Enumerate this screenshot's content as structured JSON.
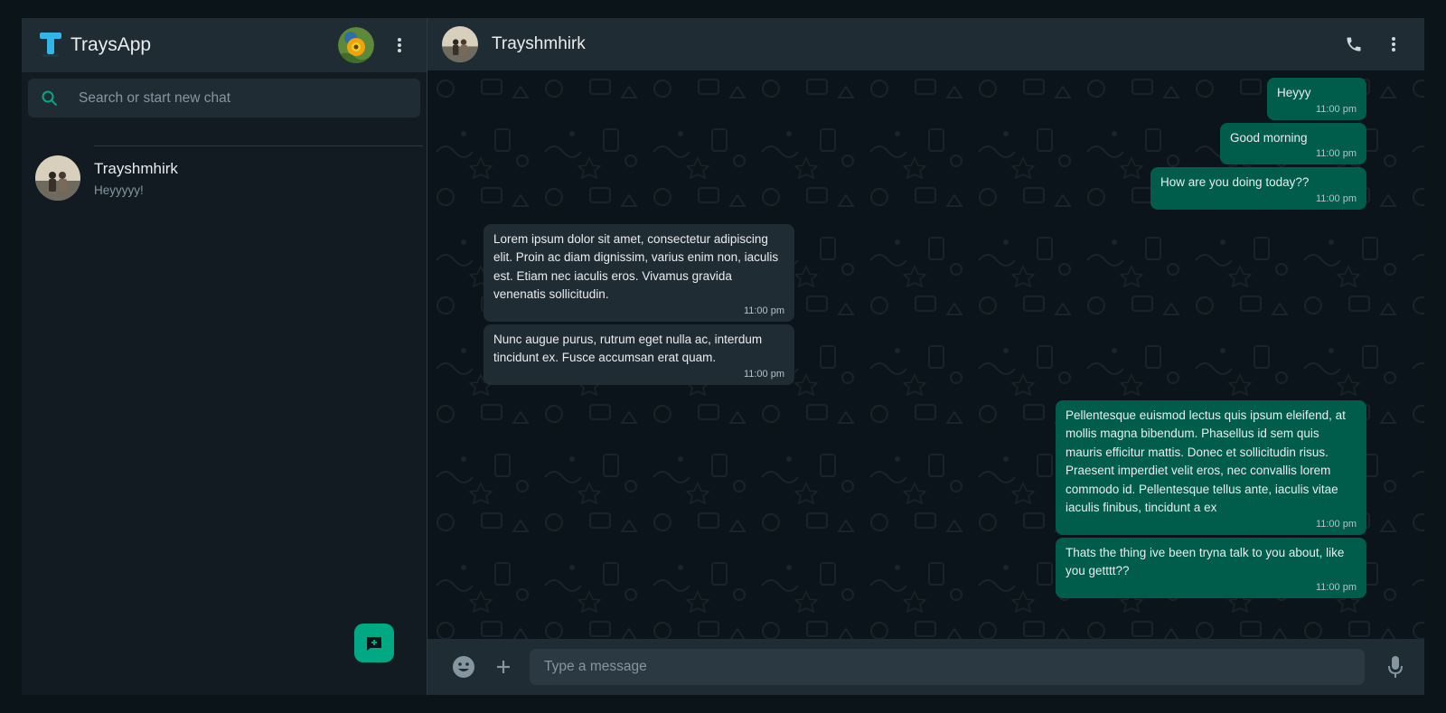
{
  "app": {
    "title": "TraysApp"
  },
  "search": {
    "placeholder": "Search or start new chat"
  },
  "chats": [
    {
      "name": "Trayshmhirk",
      "last_message": "Heyyyyy!"
    }
  ],
  "conversation": {
    "contact_name": "Trayshmhirk",
    "messages": [
      {
        "direction": "out",
        "text": "Heyyy",
        "time": "11:00 pm"
      },
      {
        "direction": "out",
        "text": "Good morning",
        "time": "11:00 pm"
      },
      {
        "direction": "out",
        "text": "How are you doing today??",
        "time": "11:00 pm"
      },
      {
        "direction": "in",
        "text": "Lorem ipsum dolor sit amet, consectetur adipiscing elit. Proin ac diam dignissim, varius enim non, iaculis est. Etiam nec iaculis eros. Vivamus gravida venenatis sollicitudin.",
        "time": "11:00 pm"
      },
      {
        "direction": "in",
        "text": "Nunc augue purus, rutrum eget nulla ac, interdum tincidunt ex. Fusce accumsan erat quam.",
        "time": "11:00 pm"
      },
      {
        "direction": "out",
        "text": "Pellentesque euismod lectus quis ipsum eleifend, at mollis magna bibendum. Phasellus id sem quis mauris efficitur mattis. Donec et sollicitudin risus. Praesent imperdiet velit eros, nec convallis lorem commodo id. Pellentesque tellus ante, iaculis vitae iaculis finibus, tincidunt a ex",
        "time": "11:00 pm"
      },
      {
        "direction": "out",
        "text": "Thats the thing ive been tryna talk to you about, like you getttt??",
        "time": "11:00 pm"
      }
    ]
  },
  "composer": {
    "placeholder": "Type a message"
  },
  "colors": {
    "accent": "#00a884",
    "outgoing_bubble": "#005c4b",
    "incoming_bubble": "#202c33",
    "panel": "#202c33",
    "background": "#111b21"
  },
  "icons": [
    "app-logo-icon",
    "kebab-menu-icon",
    "search-icon",
    "new-chat-icon",
    "phone-icon",
    "emoji-icon",
    "plus-icon",
    "microphone-icon"
  ]
}
